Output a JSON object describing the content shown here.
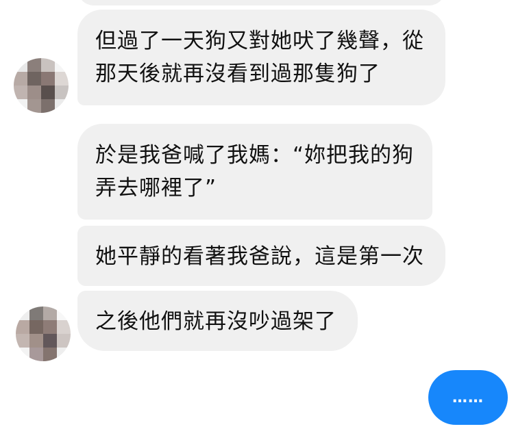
{
  "conversation": {
    "received": [
      "但過了一天狗又對她吠了幾聲，從\n那天後就再沒看到過那隻狗了",
      "於是我爸喊了我媽：“妳把我的狗\n弄去哪裡了”",
      "她平靜的看著我爸說，這是第一次",
      "之後他們就再沒吵過架了"
    ],
    "sent": "……",
    "colors": {
      "received_bubble": "#f0f0f0",
      "sent_bubble": "#1787fb",
      "text": "#111111",
      "background": "#ffffff"
    },
    "avatar_style": "pixelated/blurred"
  }
}
